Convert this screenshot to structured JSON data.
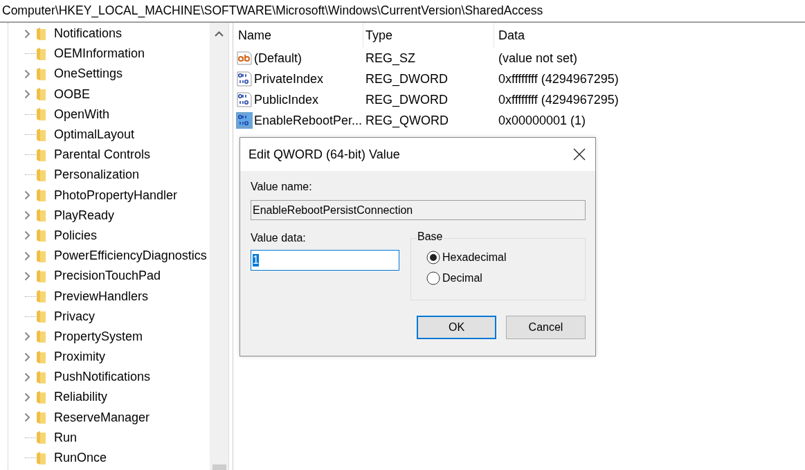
{
  "address_bar": {
    "path": "Computer\\HKEY_LOCAL_MACHINE\\SOFTWARE\\Microsoft\\Windows\\CurrentVersion\\SharedAccess"
  },
  "tree": {
    "items": [
      {
        "label": "Notifications",
        "expandable": true
      },
      {
        "label": "OEMInformation",
        "expandable": false
      },
      {
        "label": "OneSettings",
        "expandable": true
      },
      {
        "label": "OOBE",
        "expandable": true
      },
      {
        "label": "OpenWith",
        "expandable": false
      },
      {
        "label": "OptimalLayout",
        "expandable": false
      },
      {
        "label": "Parental Controls",
        "expandable": false
      },
      {
        "label": "Personalization",
        "expandable": false
      },
      {
        "label": "PhotoPropertyHandler",
        "expandable": true
      },
      {
        "label": "PlayReady",
        "expandable": true
      },
      {
        "label": "Policies",
        "expandable": true
      },
      {
        "label": "PowerEfficiencyDiagnostics",
        "expandable": true
      },
      {
        "label": "PrecisionTouchPad",
        "expandable": true
      },
      {
        "label": "PreviewHandlers",
        "expandable": false
      },
      {
        "label": "Privacy",
        "expandable": false
      },
      {
        "label": "PropertySystem",
        "expandable": true
      },
      {
        "label": "Proximity",
        "expandable": true
      },
      {
        "label": "PushNotifications",
        "expandable": true
      },
      {
        "label": "Reliability",
        "expandable": true
      },
      {
        "label": "ReserveManager",
        "expandable": true
      },
      {
        "label": "Run",
        "expandable": false
      },
      {
        "label": "RunOnce",
        "expandable": false
      }
    ]
  },
  "values": {
    "columns": [
      "Name",
      "Type",
      "Data"
    ],
    "rows": [
      {
        "name": "(Default)",
        "type": "REG_SZ",
        "data": "(value not set)",
        "kind": "string",
        "selected": false
      },
      {
        "name": "PrivateIndex",
        "type": "REG_DWORD",
        "data": "0xffffffff (4294967295)",
        "kind": "binary",
        "selected": false
      },
      {
        "name": "PublicIndex",
        "type": "REG_DWORD",
        "data": "0xffffffff (4294967295)",
        "kind": "binary",
        "selected": false
      },
      {
        "name": "EnableRebootPer...",
        "type": "REG_QWORD",
        "data": "0x00000001 (1)",
        "kind": "binary",
        "selected": true
      }
    ]
  },
  "dialog": {
    "title": "Edit QWORD (64-bit) Value",
    "value_name_label": "Value name:",
    "value_name": "EnableRebootPersistConnection",
    "value_data_label": "Value data:",
    "value_data": "1",
    "base_label": "Base",
    "radios": [
      {
        "label": "Hexadecimal",
        "selected": true
      },
      {
        "label": "Decimal",
        "selected": false
      }
    ],
    "buttons": [
      {
        "label": "OK",
        "default": true
      },
      {
        "label": "Cancel",
        "default": false
      }
    ]
  }
}
